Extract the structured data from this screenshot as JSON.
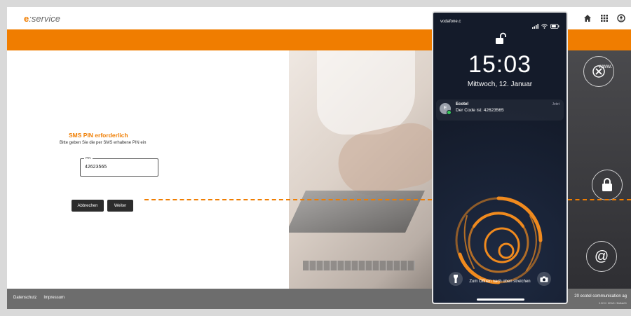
{
  "header": {
    "logo_e": "e",
    "logo_text": ":service",
    "icons": [
      "home-icon",
      "apps-grid-icon",
      "account-icon"
    ]
  },
  "form": {
    "title": "SMS PIN erforderlich",
    "subtitle": "Bitte geben Sie die per SMS erhaltene PIN ein",
    "pin_label": "PIN",
    "pin_value": "42623565",
    "cancel_label": "Abbrechen",
    "next_label": "Weiter"
  },
  "photo": {
    "www_text": "www.",
    "at_symbol": "@"
  },
  "footer": {
    "links": [
      "Datenschutz",
      "Impressum"
    ],
    "copyright": "20 ecotel communication ag",
    "version": "0.32.0 / HEAD / 3fe8ab91"
  },
  "phone": {
    "carrier": "vodafone.c",
    "time": "15:03",
    "date": "Mittwoch, 12. Januar",
    "notification": {
      "avatar_letter": "E",
      "sender": "Ecotel",
      "message": "Der Code ist: 42623565",
      "when": "Jetzt"
    },
    "hint": "Zum Öffnen nach oben streichen"
  },
  "colors": {
    "accent": "#f07d00",
    "footer": "#6d6d6d",
    "phone_bg": "#151d2e"
  }
}
